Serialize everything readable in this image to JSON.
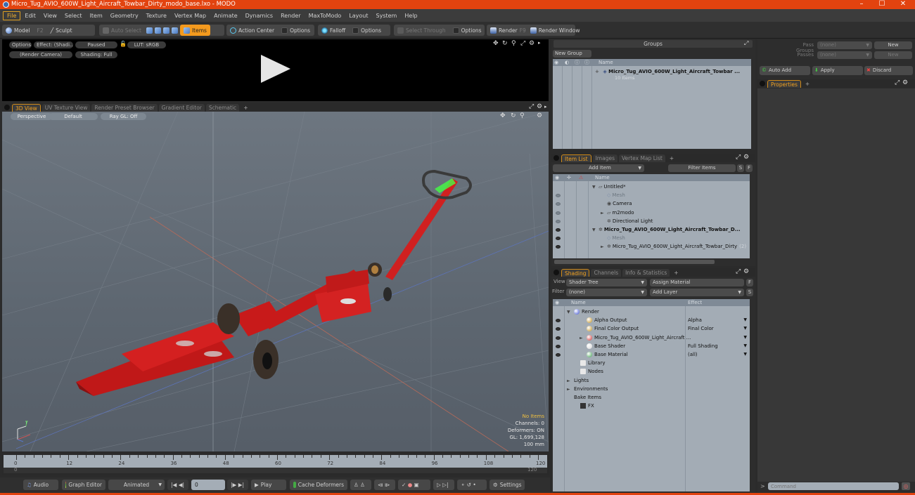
{
  "window": {
    "title": "Micro_Tug_AVIO_600W_Light_Aircraft_Towbar_Dirty_modo_base.lxo - MODO",
    "controls": [
      "minimize",
      "maximize",
      "close"
    ]
  },
  "menu": [
    "File",
    "Edit",
    "View",
    "Select",
    "Item",
    "Geometry",
    "Texture",
    "Vertex Map",
    "Animate",
    "Dynamics",
    "Render",
    "MaxToModo",
    "Layout",
    "System",
    "Help"
  ],
  "toolbar": {
    "model": "Model",
    "model_key": "F2",
    "sculpt": "Sculpt",
    "auto_select": "Auto Select",
    "items": "Items",
    "action_center": "Action Center",
    "options1": "Options",
    "falloff": "Falloff",
    "options2": "Options",
    "select_through": "Select Through",
    "options3": "Options",
    "render": "Render",
    "render_key": "F9",
    "render_window": "Render Window"
  },
  "render_preview": {
    "options": "Options",
    "effect": "Effect: (Shadi...",
    "paused": "Paused",
    "lut": "LUT: sRGB",
    "camera": "(Render Camera)",
    "shading": "Shading: Full"
  },
  "viewport_tabs": [
    "3D View",
    "UV Texture View",
    "Render Preset Browser",
    "Gradient Editor",
    "Schematic",
    "+"
  ],
  "viewport": {
    "perspective": "Perspective",
    "default": "Default",
    "raygl": "Ray GL: Off",
    "hud": {
      "items": "No Items",
      "channels": "Channels: 0",
      "deformers": "Deformers: ON",
      "gl": "GL: 1,699,128",
      "scale": "100 mm"
    },
    "axis": {
      "y": "Y"
    }
  },
  "timeline": {
    "ticks": [
      "0",
      "12",
      "24",
      "36",
      "48",
      "60",
      "72",
      "84",
      "96",
      "108",
      "120"
    ],
    "range_start": "0",
    "range_end": "120"
  },
  "bottombar": {
    "audio": "Audio",
    "graph_editor": "Graph Editor",
    "animated": "Animated",
    "frame": "0",
    "play": "Play",
    "cache_deformers": "Cache Deformers",
    "settings": "Settings"
  },
  "groups": {
    "title": "Groups",
    "new_group": "New Group",
    "col_name": "Name",
    "rows": [
      {
        "name": "Micro_Tug_AVIO_600W_Light_Aircraft_Towbar ...",
        "sub": "10 Items"
      }
    ]
  },
  "passes": {
    "pass_groups_label": "Pass Groups",
    "pass_groups_value": "(none)",
    "passes_label": "Passes",
    "passes_value": "(none)",
    "new1": "New",
    "new2": "New",
    "auto_add": "Auto Add",
    "apply": "Apply",
    "discard": "Discard"
  },
  "properties_tab": "Properties",
  "itemlist": {
    "tabs": [
      "Item List",
      "Images",
      "Vertex Map List",
      "+"
    ],
    "add_item": "Add Item",
    "filter": "Filter Items",
    "s": "S",
    "f": "F",
    "col_name": "Name",
    "rows": [
      {
        "name": "Untitled*",
        "level": 0,
        "expander": "▼",
        "style": "normal",
        "eye": false
      },
      {
        "name": "Mesh",
        "level": 1,
        "expander": "",
        "style": "dim",
        "eye": "dim"
      },
      {
        "name": "Camera",
        "level": 1,
        "expander": "",
        "style": "normal",
        "eye": "dim"
      },
      {
        "name": "m2modo",
        "level": 1,
        "expander": "►",
        "style": "normal",
        "eye": "dim"
      },
      {
        "name": "Directional Light",
        "level": 1,
        "expander": "",
        "style": "normal",
        "eye": "dim"
      },
      {
        "name": "Micro_Tug_AVIO_600W_Light_Aircraft_Towbar_D...",
        "level": 0,
        "expander": "▼",
        "style": "bold",
        "eye": true
      },
      {
        "name": "Mesh",
        "level": 1,
        "expander": "",
        "style": "dim",
        "eye": true
      },
      {
        "name": "Micro_Tug_AVIO_600W_Light_Aircraft_Towbar_Dirty",
        "level": 1,
        "expander": "►",
        "style": "normal",
        "eye": true,
        "count": "(2)"
      }
    ]
  },
  "shading": {
    "tabs": [
      "Shading",
      "Channels",
      "Info & Statistics",
      "+"
    ],
    "view_label": "View",
    "view_value": "Shader Tree",
    "assign_material": "Assign Material",
    "filter_label": "Filter",
    "filter_value": "(none)",
    "add_layer": "Add Layer",
    "f": "F",
    "s": "S",
    "col_name": "Name",
    "col_effect": "Effect",
    "rows": [
      {
        "name": "Render",
        "effect": "",
        "level": 0,
        "expander": "▼",
        "eye": false,
        "icon": "#3a4fd0"
      },
      {
        "name": "Alpha Output",
        "effect": "Alpha",
        "level": 1,
        "expander": "",
        "eye": true,
        "icon": "#c09020"
      },
      {
        "name": "Final Color Output",
        "effect": "Final Color",
        "level": 1,
        "expander": "",
        "eye": true,
        "icon": "#c09020"
      },
      {
        "name": "Micro_Tug_AVIO_600W_Light_Aircraft ...",
        "effect": "",
        "level": 1,
        "expander": "►",
        "eye": true,
        "icon": "#d03030"
      },
      {
        "name": "Base Shader",
        "effect": "Full Shading",
        "level": 1,
        "expander": "",
        "eye": true,
        "icon": "#d8d8d8"
      },
      {
        "name": "Base Material",
        "effect": "(all)",
        "level": 1,
        "expander": "",
        "eye": true,
        "icon": "#40a050"
      },
      {
        "name": "Library",
        "effect": "",
        "level": 0.5,
        "expander": "",
        "eye": false,
        "icon": "folder"
      },
      {
        "name": "Nodes",
        "effect": "",
        "level": 0.5,
        "expander": "",
        "eye": false,
        "icon": "folder"
      },
      {
        "name": "Lights",
        "effect": "",
        "level": 0,
        "expander": "►",
        "eye": false,
        "icon": ""
      },
      {
        "name": "Environments",
        "effect": "",
        "level": 0,
        "expander": "►",
        "eye": false,
        "icon": ""
      },
      {
        "name": "Bake Items",
        "effect": "",
        "level": 0,
        "expander": "",
        "eye": false,
        "icon": ""
      },
      {
        "name": "FX",
        "effect": "",
        "level": 0.5,
        "expander": "",
        "eye": false,
        "icon": "clapper"
      }
    ]
  },
  "command": {
    "prompt": ">",
    "placeholder": "Command"
  },
  "colors": {
    "accent": "#e2430f",
    "highlight": "#f39a1e",
    "list_bg": "#a3acb5"
  }
}
